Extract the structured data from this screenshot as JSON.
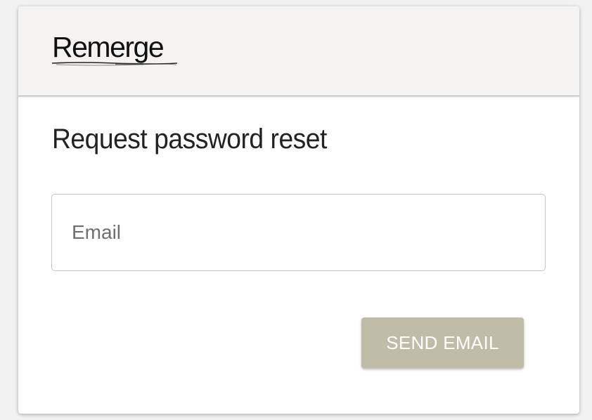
{
  "header": {
    "logo_text": "Remerge"
  },
  "form": {
    "title": "Request password reset",
    "email_placeholder": "Email",
    "email_value": "",
    "send_button_label": "SEND EMAIL"
  },
  "colors": {
    "header_background": "#f4f3f1",
    "button_background": "#bfbca8",
    "button_text": "#ffffff",
    "title_text": "#222222"
  }
}
